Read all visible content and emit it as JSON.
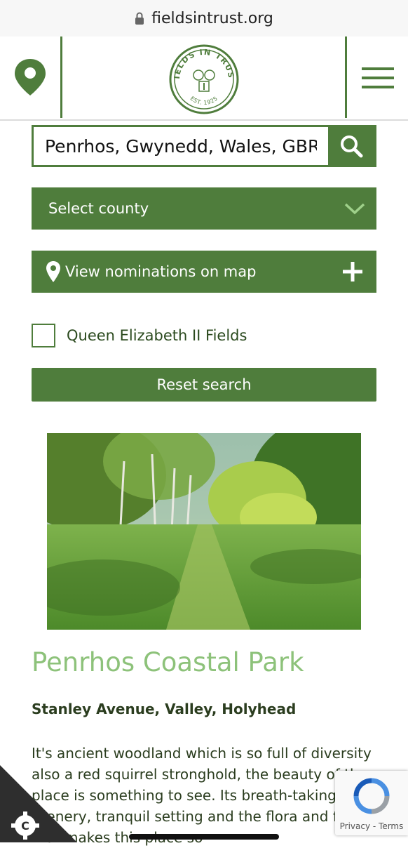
{
  "browser": {
    "url": "fieldsintrust.org"
  },
  "header": {
    "logo_text": "FIELDS IN TRUST",
    "logo_est": "EST. 1925"
  },
  "search": {
    "value": "Penrhos, Gwynedd, Wales, GBR"
  },
  "filters": {
    "county_label": "Select county",
    "map_label": "View nominations on map",
    "checkbox_label": "Queen Elizabeth II Fields",
    "reset_label": "Reset search"
  },
  "result": {
    "title": "Penrhos Coastal Park",
    "address": "Stanley Avenue, Valley, Holyhead",
    "description": "It's ancient woodland which is so full of diversity also a red squirrel stronghold, the beauty of the place is something to see. Its breath-taking scenery, tranquil setting and the flora and fauna that makes this place so"
  },
  "recaptcha": {
    "terms": "Privacy - Terms"
  },
  "colors": {
    "brand_green": "#4f7d3c",
    "title_green": "#8dc27a"
  }
}
